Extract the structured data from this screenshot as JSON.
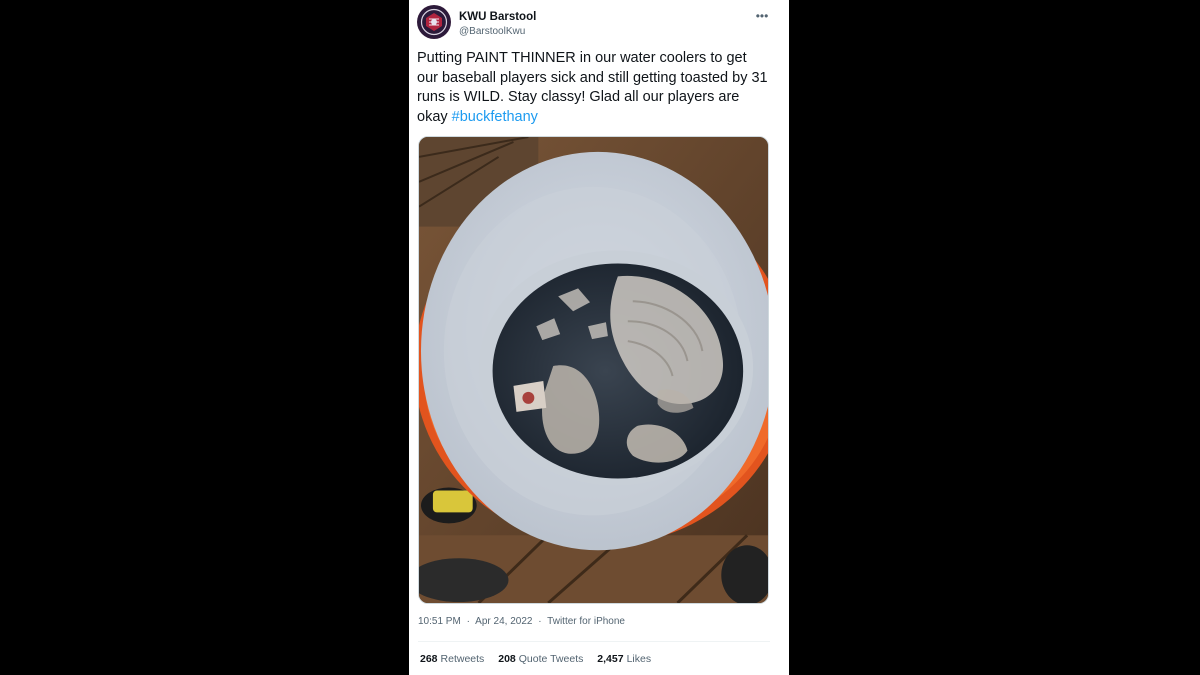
{
  "tweet": {
    "display_name": "KWU Barstool",
    "handle": "@BarstoolKwu",
    "more_icon": "more-horizontal-icon",
    "text_plain": "Putting PAINT THINNER in our water coolers to get our baseball players sick and still getting toasted by 31 runs is WILD. Stay classy! Glad all our players are okay ",
    "hashtag": "#buckfethany",
    "time": "10:51 PM",
    "date": "Apr 24, 2022",
    "source": "Twitter for iPhone",
    "separator": "·"
  },
  "stats": {
    "retweets_count": "268",
    "retweets_label": "Retweets",
    "quote_count": "208",
    "quote_label": "Quote Tweets",
    "likes_count": "2,457",
    "likes_label": "Likes"
  },
  "colors": {
    "background": "#000000",
    "card": "#ffffff",
    "text": "#0f1419",
    "secondary": "#536471",
    "link": "#1d9bf0"
  }
}
